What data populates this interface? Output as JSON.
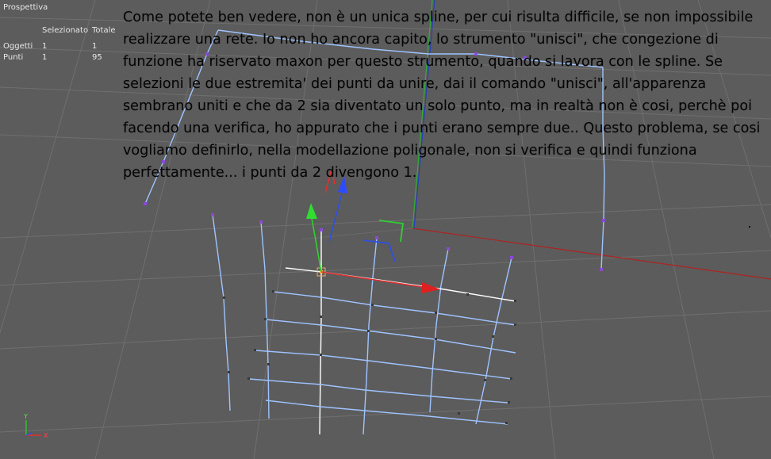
{
  "viewport": {
    "title": "Prospettiva",
    "stats": {
      "header_selected": "Selezionato",
      "header_total": "Totale",
      "rows": [
        {
          "label": "Oggetti",
          "selected": "1",
          "total": "1"
        },
        {
          "label": "Punti",
          "selected": "1",
          "total": "95"
        }
      ]
    },
    "note": "Come potete ben vedere, non è un unica spline, per cui risulta difficile, se non impossibile realizzare una rete. Io non ho ancora capito, lo strumento \"unisci\", che congezione di funzione ha riservato maxon per questo strumento, quando si lavora con le spline. Se selezioni le due estremita' dei punti da unire, dai il comando \"unisci\", all'apparenza sembrano uniti e che da 2 sia diventato un solo punto, ma in realtà non è cosi, perchè poi facendo una verifica, ho appurato che i punti erano sempre due.. Questo problema, se cosi vogliamo definirlo, nella modellazione poligonale, non si verifica e quindi funziona perfettamente... i punti da 2 divengono 1.",
    "axis_labels": {
      "y": "Y",
      "x": "X"
    },
    "colors": {
      "background": "#5c5c5c",
      "grid": "#6e6e6e",
      "spline": "#9fc3ff",
      "point": "#8a4ad8",
      "axis_x": "#e02020",
      "axis_y": "#30d030",
      "axis_z": "#3050e0"
    }
  }
}
